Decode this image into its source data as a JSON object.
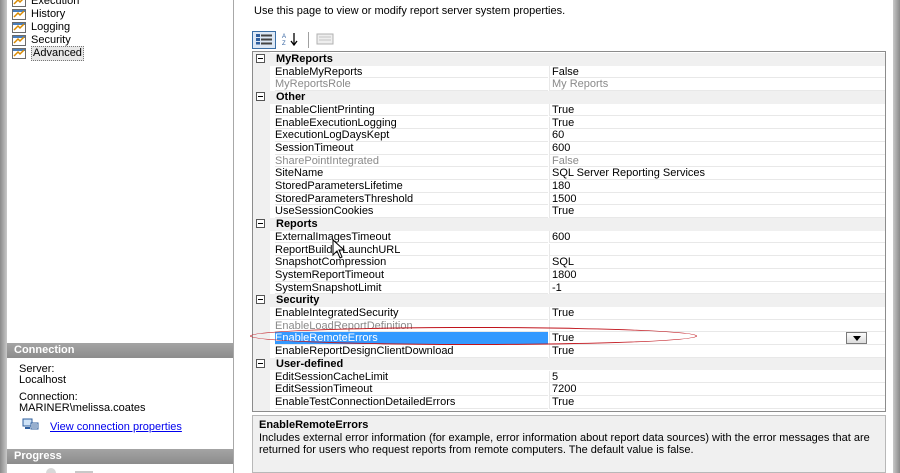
{
  "nav": {
    "items": [
      {
        "label": "Execution"
      },
      {
        "label": "History"
      },
      {
        "label": "Logging"
      },
      {
        "label": "Security"
      },
      {
        "label": "Advanced"
      }
    ]
  },
  "connection": {
    "header": "Connection",
    "server_label": "Server:",
    "server_value": "Localhost",
    "connection_label": "Connection:",
    "connection_value": "MARINER\\melissa.coates",
    "view_link": "View connection properties"
  },
  "progress": {
    "header": "Progress"
  },
  "main": {
    "description": "Use this page to view or modify report server system properties."
  },
  "grid": {
    "categories": [
      {
        "name": "MyReports",
        "props": [
          {
            "name": "EnableMyReports",
            "value": "False",
            "disabled": false
          },
          {
            "name": "MyReportsRole",
            "value": "My Reports",
            "disabled": true
          }
        ]
      },
      {
        "name": "Other",
        "props": [
          {
            "name": "EnableClientPrinting",
            "value": "True",
            "disabled": false
          },
          {
            "name": "EnableExecutionLogging",
            "value": "True",
            "disabled": false
          },
          {
            "name": "ExecutionLogDaysKept",
            "value": "60",
            "disabled": false
          },
          {
            "name": "SessionTimeout",
            "value": "600",
            "disabled": false
          },
          {
            "name": "SharePointIntegrated",
            "value": "False",
            "disabled": true
          },
          {
            "name": "SiteName",
            "value": "SQL Server Reporting Services",
            "disabled": false
          },
          {
            "name": "StoredParametersLifetime",
            "value": "180",
            "disabled": false
          },
          {
            "name": "StoredParametersThreshold",
            "value": "1500",
            "disabled": false
          },
          {
            "name": "UseSessionCookies",
            "value": "True",
            "disabled": false
          }
        ]
      },
      {
        "name": "Reports",
        "props": [
          {
            "name": "ExternalImagesTimeout",
            "value": "600",
            "disabled": false
          },
          {
            "name": "ReportBuilderLaunchURL",
            "value": "",
            "disabled": false
          },
          {
            "name": "SnapshotCompression",
            "value": "SQL",
            "disabled": false
          },
          {
            "name": "SystemReportTimeout",
            "value": "1800",
            "disabled": false
          },
          {
            "name": "SystemSnapshotLimit",
            "value": "-1",
            "disabled": false
          }
        ]
      },
      {
        "name": "Security",
        "props": [
          {
            "name": "EnableIntegratedSecurity",
            "value": "True",
            "disabled": false
          },
          {
            "name": "EnableLoadReportDefinition",
            "value": "",
            "disabled": true
          },
          {
            "name": "EnableRemoteErrors",
            "value": "True",
            "disabled": false,
            "selected": true
          },
          {
            "name": "EnableReportDesignClientDownload",
            "value": "True",
            "disabled": false
          }
        ]
      },
      {
        "name": "User-defined",
        "props": [
          {
            "name": "EditSessionCacheLimit",
            "value": "5",
            "disabled": false
          },
          {
            "name": "EditSessionTimeout",
            "value": "7200",
            "disabled": false
          },
          {
            "name": "EnableTestConnectionDetailedErrors",
            "value": "True",
            "disabled": false
          }
        ]
      }
    ]
  },
  "description_panel": {
    "title": "EnableRemoteErrors",
    "body": "Includes external error information (for example, error information about report data sources) with the error messages that are returned for users who request reports from remote computers. The default value is false."
  },
  "colors": {
    "selection": "#3399ff",
    "highlight_oval": "#c0141c",
    "link": "#0000ee"
  }
}
